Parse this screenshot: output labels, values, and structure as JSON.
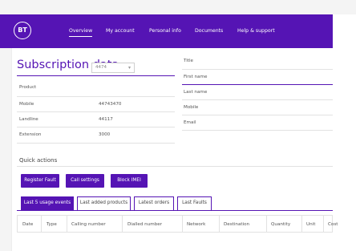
{
  "header": {
    "logo": "BT",
    "nav": [
      "Overview",
      "My account",
      "Personal info",
      "Documents",
      "Help & support"
    ]
  },
  "subscription": {
    "title": "Subscription data",
    "account_select": "4474",
    "fields": [
      {
        "label": "Product",
        "value": ""
      },
      {
        "label": "Mobile",
        "value": "44743470"
      },
      {
        "label": "Landline",
        "value": "44117"
      },
      {
        "label": "Extension",
        "value": "3000"
      }
    ]
  },
  "personal": {
    "fields": [
      "Title",
      "First name",
      "Last name",
      "Mobile",
      "Email"
    ]
  },
  "quick_actions": {
    "title": "Quick actions",
    "buttons": [
      "Register Fault",
      "Call settings",
      "Block IMEI"
    ]
  },
  "tabs": [
    "Last 5 usage events",
    "Last added products",
    "Latest orders",
    "Last Faults"
  ],
  "table": {
    "columns": [
      "Date",
      "Type",
      "Calling number",
      "Dialled number",
      "Network",
      "Destination",
      "Quantity",
      "Unit",
      "Cost"
    ]
  },
  "colors": {
    "brand": "#5514b4"
  }
}
